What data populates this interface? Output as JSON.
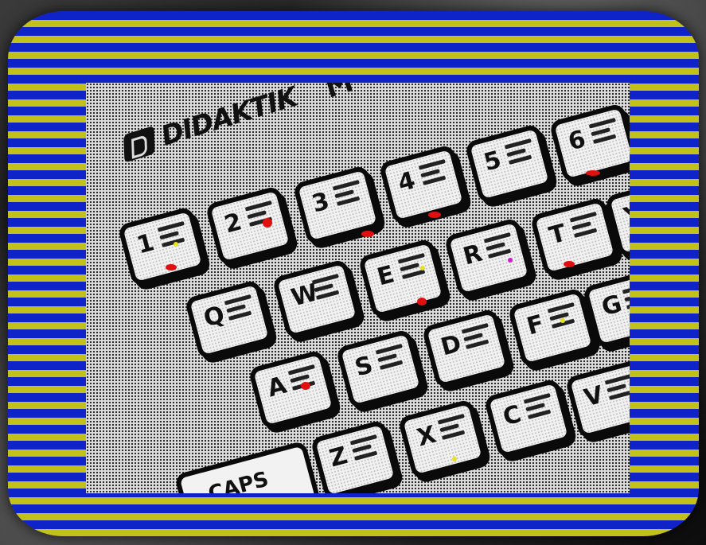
{
  "brand": {
    "logo_text": "DIDAKTIK M",
    "logo_text_display": "DIDAKTIK",
    "model_mark": "M"
  },
  "keyboard": {
    "row_numbers": [
      "1",
      "2",
      "3",
      "4",
      "5",
      "6"
    ],
    "row_top": [
      "Q",
      "W",
      "E",
      "R",
      "T",
      "Y"
    ],
    "row_home": [
      "A",
      "S",
      "D",
      "F",
      "G"
    ],
    "row_bottom": [
      "Z",
      "X",
      "C",
      "V"
    ],
    "caps_label": "CAPS"
  },
  "colors": {
    "border_blue": "#0f23c8",
    "border_yellow": "#c2c01a",
    "accent_red": "#e01010",
    "accent_yellow": "#e8e020",
    "accent_magenta": "#d020d0"
  }
}
